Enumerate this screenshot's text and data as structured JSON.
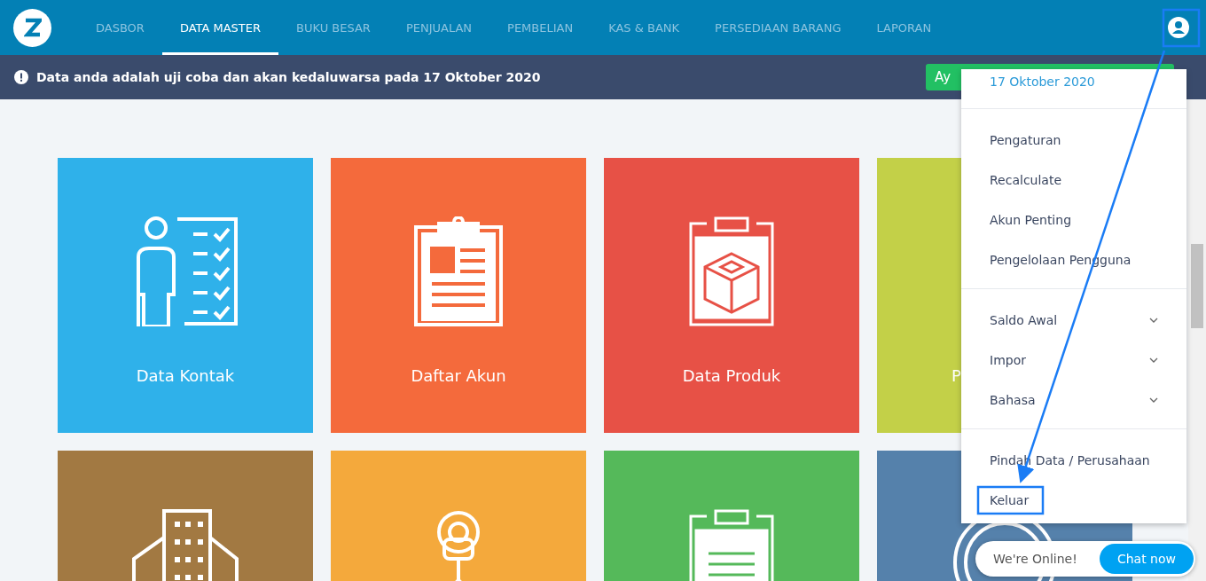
{
  "nav": {
    "tabs": [
      {
        "label": "DASBOR",
        "selected": false
      },
      {
        "label": "DATA MASTER",
        "selected": true
      },
      {
        "label": "BUKU BESAR",
        "selected": false
      },
      {
        "label": "PENJUALAN",
        "selected": false
      },
      {
        "label": "PEMBELIAN",
        "selected": false
      },
      {
        "label": "KAS & BANK",
        "selected": false
      },
      {
        "label": "PERSEDIAAN BARANG",
        "selected": false
      },
      {
        "label": "LAPORAN",
        "selected": false
      }
    ]
  },
  "banner": {
    "message": "Data anda adalah uji coba dan akan kedaluwarsa pada 17 Oktober 2020",
    "button": "Ay"
  },
  "tiles": [
    {
      "kind": "contacts",
      "label": "Data Kontak",
      "color": "#2fb1ea"
    },
    {
      "kind": "accounts",
      "label": "Daftar Akun",
      "color": "#f46a3c"
    },
    {
      "kind": "products",
      "label": "Data Produk",
      "color": "#e75146"
    },
    {
      "kind": "scale",
      "label": "P",
      "color": "#c3d048"
    },
    {
      "kind": "building",
      "color": "#a27942"
    },
    {
      "kind": "network",
      "color": "#f4a93c"
    },
    {
      "kind": "clipboard",
      "color": "#55b95a"
    },
    {
      "kind": "gauge",
      "color": "#5581ab"
    }
  ],
  "user_menu": {
    "date": "17 Oktober 2020",
    "sections": [
      [
        {
          "label": "Pengaturan",
          "kind": "link"
        },
        {
          "label": "Recalculate",
          "kind": "link"
        },
        {
          "label": "Akun Penting",
          "kind": "link"
        },
        {
          "label": "Pengelolaan Pengguna",
          "kind": "link"
        }
      ],
      [
        {
          "label": "Saldo Awal",
          "kind": "submenu"
        },
        {
          "label": "Impor",
          "kind": "submenu"
        },
        {
          "label": "Bahasa",
          "kind": "submenu"
        }
      ],
      [
        {
          "label": "Pindah Data / Perusahaan",
          "kind": "link"
        },
        {
          "label": "Keluar",
          "kind": "link"
        }
      ]
    ]
  },
  "chat": {
    "status": "We're Online!",
    "button": "Chat now"
  }
}
